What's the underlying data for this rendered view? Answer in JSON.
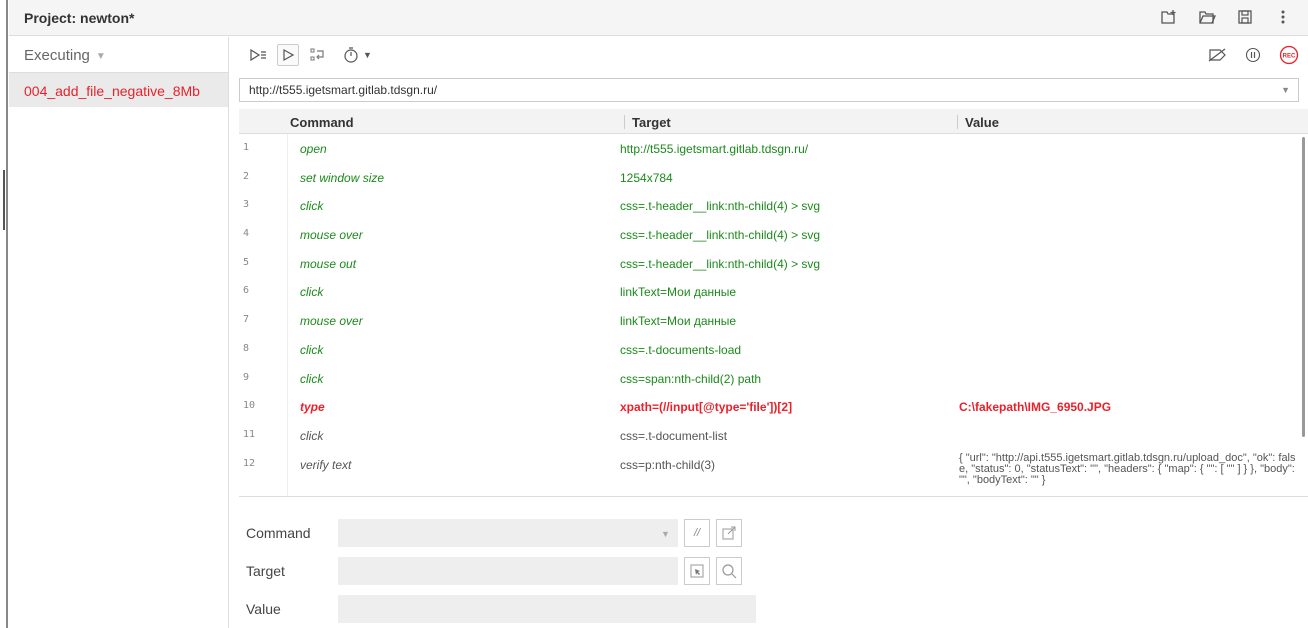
{
  "header": {
    "title": "Project:  newton*"
  },
  "sidebar": {
    "selector_label": "Executing",
    "tests": [
      {
        "label": "004_add_file_negative_8Mb"
      }
    ]
  },
  "toolbar": {
    "record_label": "REC"
  },
  "url_bar": {
    "value": "http://t555.igetsmart.gitlab.tdsgn.ru/"
  },
  "table": {
    "headers": {
      "command": "Command",
      "target": "Target",
      "value": "Value"
    },
    "rows": [
      {
        "num": "1",
        "command": "open",
        "target": "http://t555.igetsmart.gitlab.tdsgn.ru/",
        "value": ""
      },
      {
        "num": "2",
        "command": "set window size",
        "target": "1254x784",
        "value": ""
      },
      {
        "num": "3",
        "command": "click",
        "target": "css=.t-header__link:nth-child(4) > svg",
        "value": ""
      },
      {
        "num": "4",
        "command": "mouse over",
        "target": "css=.t-header__link:nth-child(4) > svg",
        "value": ""
      },
      {
        "num": "5",
        "command": "mouse out",
        "target": "css=.t-header__link:nth-child(4) > svg",
        "value": ""
      },
      {
        "num": "6",
        "command": "click",
        "target": "linkText=Мои данные",
        "value": ""
      },
      {
        "num": "7",
        "command": "mouse over",
        "target": "linkText=Мои данные",
        "value": ""
      },
      {
        "num": "8",
        "command": "click",
        "target": "css=.t-documents-load",
        "value": ""
      },
      {
        "num": "9",
        "command": "click",
        "target": "css=span:nth-child(2) path",
        "value": ""
      },
      {
        "num": "10",
        "command": "type",
        "target": "xpath=(//input[@type='file'])[2]",
        "value": "C:\\fakepath\\IMG_6950.JPG"
      },
      {
        "num": "11",
        "command": "click",
        "target": "css=.t-document-list",
        "value": ""
      },
      {
        "num": "12",
        "command": "verify text",
        "target": "css=p:nth-child(3)",
        "value": "{ \"url\": \"http://api.t555.igetsmart.gitlab.tdsgn.ru/upload_doc\", \"ok\": false, \"status\": 0, \"statusText\": \"\", \"headers\": { \"map\": { \"\": [ \"\" ] } }, \"body\": \"\", \"bodyText\": \"\" }"
      }
    ]
  },
  "form": {
    "command_label": "Command",
    "target_label": "Target",
    "value_label": "Value",
    "comment_button": "//"
  },
  "colors": {
    "green": "#1a8a1a",
    "red": "#e8222b"
  }
}
